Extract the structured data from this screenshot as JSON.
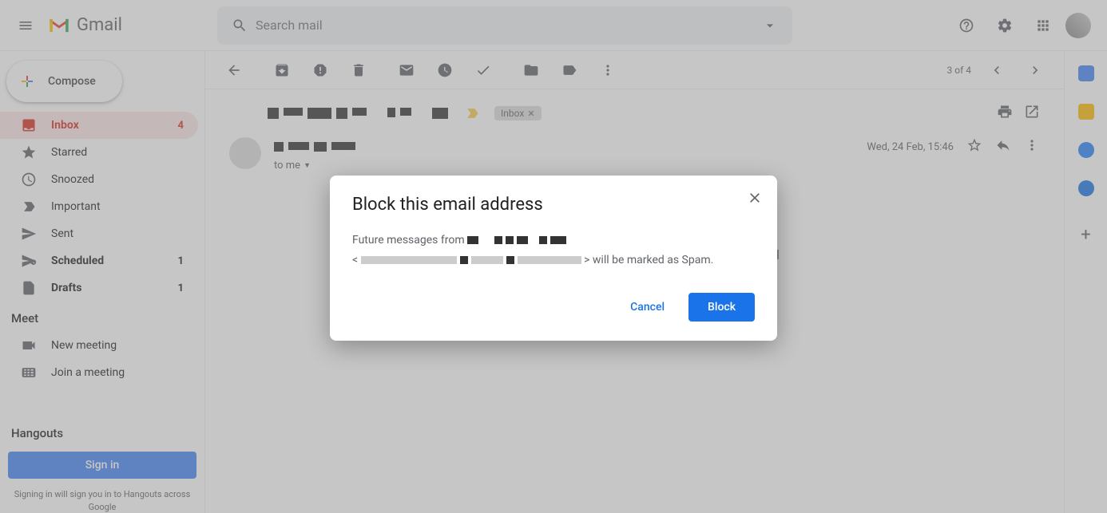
{
  "header": {
    "app_name": "Gmail",
    "search_placeholder": "Search mail"
  },
  "compose_label": "Compose",
  "sidebar": {
    "items": [
      {
        "label": "Inbox",
        "count": "4"
      },
      {
        "label": "Starred",
        "count": ""
      },
      {
        "label": "Snoozed",
        "count": ""
      },
      {
        "label": "Important",
        "count": ""
      },
      {
        "label": "Sent",
        "count": ""
      },
      {
        "label": "Scheduled",
        "count": "1"
      },
      {
        "label": "Drafts",
        "count": "1"
      }
    ],
    "meet_heading": "Meet",
    "meet_items": [
      {
        "label": "New meeting"
      },
      {
        "label": "Join a meeting"
      }
    ],
    "hangouts_heading": "Hangouts",
    "signin_label": "Sign in",
    "signin_note": "Signing in will sign you in to Hangouts across Google"
  },
  "toolbar": {
    "page_indicator": "3 of 4"
  },
  "message": {
    "inbox_chip": "Inbox",
    "date": "Wed, 24 Feb, 15:46",
    "to_line": "to me"
  },
  "dialog": {
    "title": "Block this email address",
    "body_prefix": "Future messages from ",
    "body_mid_open": "<",
    "body_suffix": "> will be marked as Spam.",
    "cancel": "Cancel",
    "block": "Block"
  }
}
